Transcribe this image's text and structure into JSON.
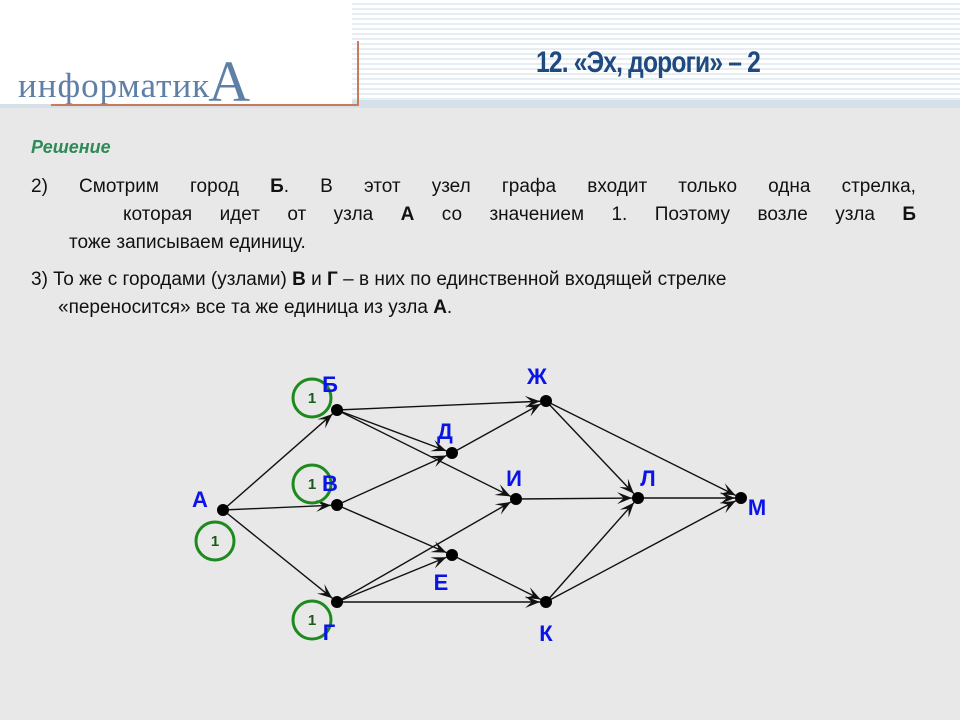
{
  "header": {
    "logo_text": "информатик",
    "logo_big_letter": "А",
    "title": "12. «Эх, дороги» – 2"
  },
  "content": {
    "heading": "Решение",
    "step2": {
      "line1": [
        "2)",
        "Смотрим",
        "город",
        "Б.",
        "В",
        "этот",
        "узел",
        "графа",
        "входит",
        "только",
        "одна",
        "стрелка,"
      ],
      "line2": [
        "которая",
        "идет",
        "от",
        "узла",
        "А",
        "со",
        "значением",
        "1.",
        "Поэтому",
        "возле",
        "узла",
        "Б"
      ],
      "line3": "тоже записываем единицу."
    },
    "step3": {
      "line1_a": "3) То же с городами (узлами) ",
      "line1_b": "В",
      "line1_c": " и ",
      "line1_d": "Г",
      "line1_e": " – в них по единственной входящей стрелке",
      "line2_a": "«переносится» все та же единица из узла ",
      "line2_b": "А",
      "line2_c": "."
    }
  },
  "graph": {
    "colors": {
      "label": "#0a14e6",
      "value_circle": "#1e8a1e",
      "edge": "#111111"
    },
    "nodes": [
      {
        "id": "A",
        "label": "А",
        "value": "1"
      },
      {
        "id": "B",
        "label": "Б",
        "value": "1"
      },
      {
        "id": "V",
        "label": "В",
        "value": "1"
      },
      {
        "id": "G",
        "label": "Г",
        "value": "1"
      },
      {
        "id": "D",
        "label": "Д"
      },
      {
        "id": "E",
        "label": "Е"
      },
      {
        "id": "Zh",
        "label": "Ж"
      },
      {
        "id": "I",
        "label": "И"
      },
      {
        "id": "K",
        "label": "К"
      },
      {
        "id": "L",
        "label": "Л"
      },
      {
        "id": "M",
        "label": "М"
      }
    ],
    "edges": [
      [
        "A",
        "B"
      ],
      [
        "A",
        "V"
      ],
      [
        "A",
        "G"
      ],
      [
        "B",
        "Zh"
      ],
      [
        "B",
        "D"
      ],
      [
        "B",
        "I"
      ],
      [
        "V",
        "D"
      ],
      [
        "V",
        "E"
      ],
      [
        "G",
        "E"
      ],
      [
        "G",
        "I"
      ],
      [
        "G",
        "K"
      ],
      [
        "D",
        "Zh"
      ],
      [
        "E",
        "K"
      ],
      [
        "Zh",
        "L"
      ],
      [
        "Zh",
        "M"
      ],
      [
        "I",
        "L"
      ],
      [
        "K",
        "L"
      ],
      [
        "K",
        "M"
      ],
      [
        "L",
        "M"
      ]
    ]
  }
}
